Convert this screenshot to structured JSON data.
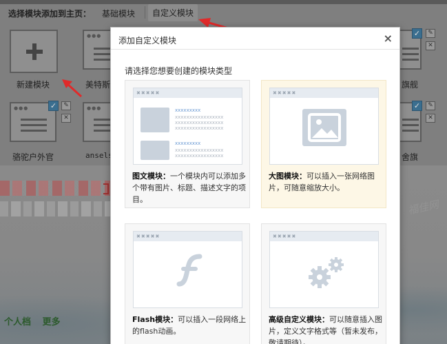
{
  "header": {
    "label": "选择模块添加到主页：",
    "tabs": [
      "基础模块",
      "自定义模块"
    ]
  },
  "background_modules": {
    "new_module_label": "新建模块",
    "row1": [
      "美特斯",
      "旗舰"
    ],
    "row2": [
      "骆驼户外官",
      "ansels",
      "舍旗"
    ],
    "watermark": "福佳网",
    "footer_links": [
      "个人档",
      "更多"
    ]
  },
  "modal": {
    "title": "添加自定义模块",
    "close": "×",
    "intro": "请选择您想要创建的模块类型",
    "cards": [
      {
        "name": "图文模块：",
        "desc": "一个模块内可以添加多个带有图片、标题、描述文字的项目。"
      },
      {
        "name": "大图模块：",
        "desc": "可以插入一张网络图片，可随意缩放大小。"
      },
      {
        "name": "Flash模块：",
        "desc": "可以插入一段网络上的flash动画。"
      },
      {
        "name": "高级自定义模块：",
        "desc": "可以随意插入图片，定义文字格式等（暂未发布，敬请期待）。"
      }
    ],
    "placeholder": {
      "dots": "✖✖✖✖✖",
      "link": "xxxxxxxxx",
      "text": "xxxxxxxxxxxxxxxxx"
    }
  },
  "colors": {
    "arrow": "#e02a2a",
    "selected_card_bg": "#fdf7e6",
    "placeholder_gray": "#c9d2dc",
    "link_blue": "#6b9ad3"
  }
}
